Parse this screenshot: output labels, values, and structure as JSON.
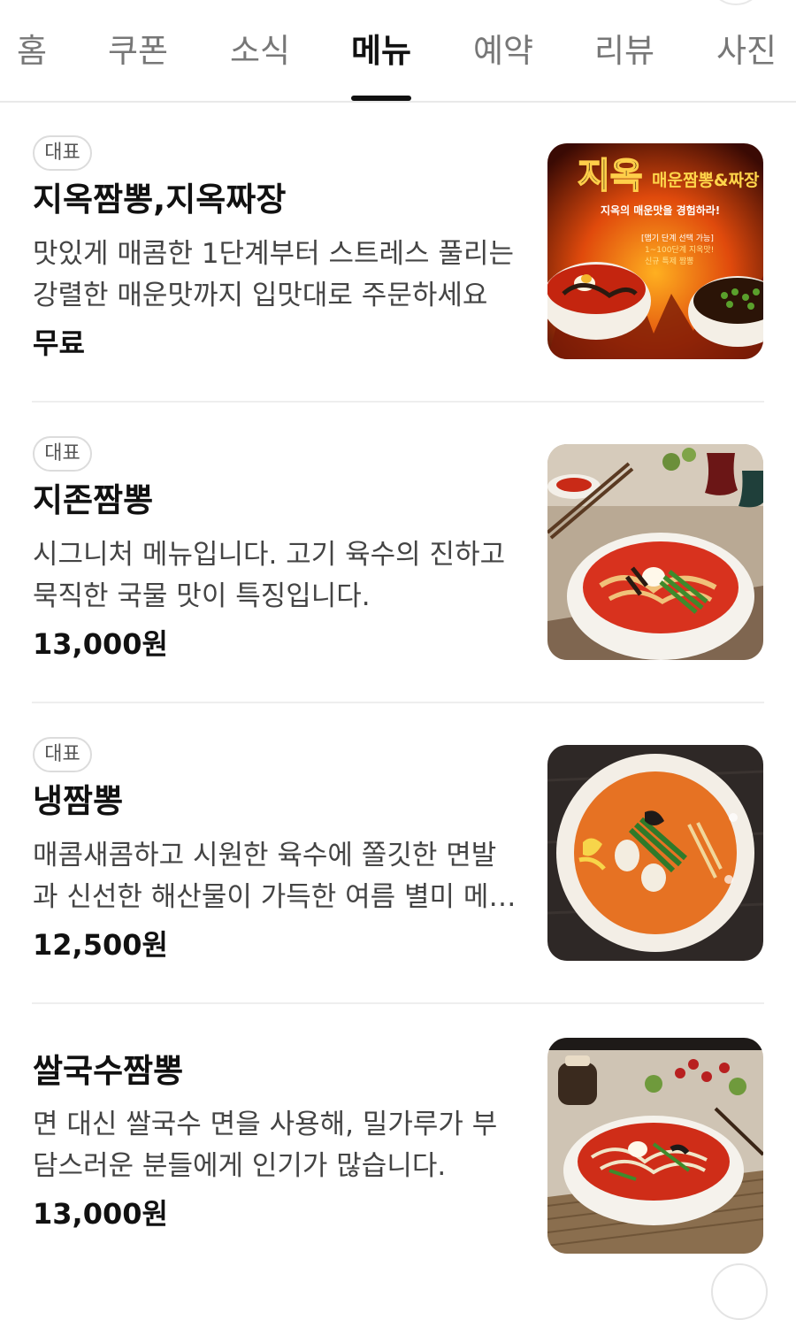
{
  "tabs": [
    {
      "label": "홈",
      "active": false
    },
    {
      "label": "쿠폰",
      "active": false
    },
    {
      "label": "소식",
      "active": false
    },
    {
      "label": "메뉴",
      "active": true
    },
    {
      "label": "예약",
      "active": false
    },
    {
      "label": "리뷰",
      "active": false
    },
    {
      "label": "사진",
      "active": false
    }
  ],
  "menu": {
    "items": [
      {
        "badge": "대표",
        "name": "지옥짬뽕,지옥짜장",
        "description": "맛있게 매콤한 1단계부터 스트레스 풀리는 강렬한 매운맛까지 입맛대로 주문하세요",
        "price": "무료",
        "image": {
          "title": "지옥",
          "subtitle": "매운짬뽕&짜장",
          "tagline": "지옥의 매운맛을 경험하라!",
          "note1": "[맵기 단계 선택 가능]",
          "note2": "1~100단계 지옥맛!",
          "note3": "신규 특제 짬뽕"
        }
      },
      {
        "badge": "대표",
        "name": "지존짬뽕",
        "description": "시그니처 메뉴입니다. 고기 육수의 진하고 묵직한 국물 맛이 특징입니다.",
        "price": "13,000원"
      },
      {
        "badge": "대표",
        "name": "냉짬뽕",
        "description": "매콤새콤하고 시원한 육수에 쫄깃한 면발과 신선한 해산물이 가득한 여름 별미 메뉴입니다",
        "price": "12,500원"
      },
      {
        "badge": "",
        "name": "쌀국수짬뽕",
        "description": "면 대신 쌀국수 면을 사용해, 밀가루가 부담스러운 분들에게 인기가 많습니다.",
        "price": "13,000원"
      }
    ]
  },
  "colors": {
    "accent_text": "#111111",
    "muted_text": "#777777",
    "soup_red": "#d8321e",
    "fire_orange": "#f07a10"
  },
  "icons": [
    "hell-jjamppong-photo",
    "jjamppong-photo",
    "cold-jjamppong-photo",
    "rice-noodle-jjamppong-photo"
  ]
}
